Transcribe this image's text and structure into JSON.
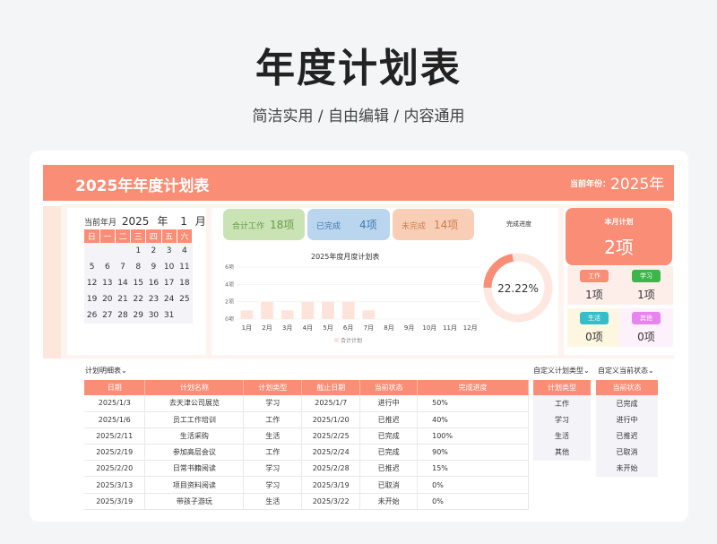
{
  "heading": {
    "title": "年度计划表",
    "subtitle": "简洁实用 / 自由编辑 / 内容通用"
  },
  "banner": {
    "title": "2025年年度计划表",
    "year_label": "当前年份：",
    "year": "2025年"
  },
  "calendar": {
    "label": "当前年月",
    "year": "2025",
    "year_unit": "年",
    "month": "1",
    "month_unit": "月",
    "weekdays": [
      "日",
      "一",
      "二",
      "三",
      "四",
      "五",
      "六"
    ],
    "weeks": [
      [
        "",
        "",
        "",
        "1",
        "2",
        "3",
        "4"
      ],
      [
        "5",
        "6",
        "7",
        "8",
        "9",
        "10",
        "11"
      ],
      [
        "12",
        "13",
        "14",
        "15",
        "16",
        "17",
        "18"
      ],
      [
        "19",
        "20",
        "21",
        "22",
        "23",
        "24",
        "25"
      ],
      [
        "26",
        "27",
        "28",
        "29",
        "30",
        "31",
        ""
      ]
    ]
  },
  "stats": [
    {
      "label": "合计工作",
      "value": "18项",
      "color": "#c9e3b4",
      "text_color": "#6a9a47"
    },
    {
      "label": "已完成",
      "value": "4项",
      "color": "#b9d6ee",
      "text_color": "#3f79ad"
    },
    {
      "label": "未完成",
      "value": "14项",
      "color": "#f8cfb6",
      "text_color": "#d17b4e"
    }
  ],
  "chart_data": {
    "type": "bar",
    "title": "2025年度月度计划表",
    "categories": [
      "1月",
      "2月",
      "3月",
      "4月",
      "5月",
      "6月",
      "7月",
      "8月",
      "9月",
      "10月",
      "11月",
      "12月"
    ],
    "series": [
      {
        "name": "合计计划",
        "values": [
          1,
          2,
          1,
          2,
          2,
          2,
          1,
          0,
          0,
          0,
          0,
          0
        ]
      }
    ],
    "yticks": [
      "0项",
      "2项",
      "4项",
      "6项"
    ],
    "ylim": [
      0,
      6
    ],
    "color": "#fde3da",
    "legend_position": "bottom"
  },
  "progress": {
    "title": "完成进度",
    "value_text": "22.22%",
    "fraction": 0.2222,
    "color": "#f98d75",
    "track": "#fde7df"
  },
  "month_plan": {
    "label": "本月计划",
    "value": "2项",
    "categories": [
      {
        "tag": "工作",
        "value": "1项",
        "tag_color": "#f98d75",
        "bg": "#fdeeea"
      },
      {
        "tag": "学习",
        "value": "1项",
        "tag_color": "#3cb54a",
        "bg": "#fdeeea"
      },
      {
        "tag": "生活",
        "value": "0项",
        "tag_color": "#34bec9",
        "bg": "#fdf6e0"
      },
      {
        "tag": "其他",
        "value": "0项",
        "tag_color": "#e884f0",
        "bg": "#fdf1fb"
      }
    ]
  },
  "detail_table": {
    "caption": "计划明细表",
    "columns": [
      "日期",
      "计划名称",
      "计划类型",
      "截止日期",
      "当前状态",
      "完成进度"
    ],
    "rows": [
      [
        "2025/1/3",
        "去天津公司展览",
        "学习",
        "2025/1/7",
        "进行中",
        "50%"
      ],
      [
        "2025/1/6",
        "员工工作培训",
        "工作",
        "2025/1/20",
        "已推迟",
        "40%"
      ],
      [
        "2025/2/11",
        "生活采购",
        "生活",
        "2025/2/25",
        "已完成",
        "100%"
      ],
      [
        "2025/2/19",
        "参加高层会议",
        "工作",
        "2025/2/24",
        "已完成",
        "90%"
      ],
      [
        "2025/2/20",
        "日常书籍阅读",
        "学习",
        "2025/2/28",
        "已推迟",
        "15%"
      ],
      [
        "2025/3/13",
        "项目资料阅读",
        "学习",
        "2025/3/19",
        "已取消",
        "0%"
      ],
      [
        "2025/3/19",
        "带孩子游玩",
        "生活",
        "2025/3/22",
        "未开始",
        "0%"
      ]
    ]
  },
  "type_table": {
    "caption": "自定义计划类型",
    "header": "计划类型",
    "items": [
      "工作",
      "学习",
      "生活",
      "其他"
    ]
  },
  "status_table": {
    "caption": "自定义当前状态",
    "header": "当前状态",
    "items": [
      "已完成",
      "进行中",
      "已推迟",
      "已取消",
      "未开始"
    ]
  }
}
